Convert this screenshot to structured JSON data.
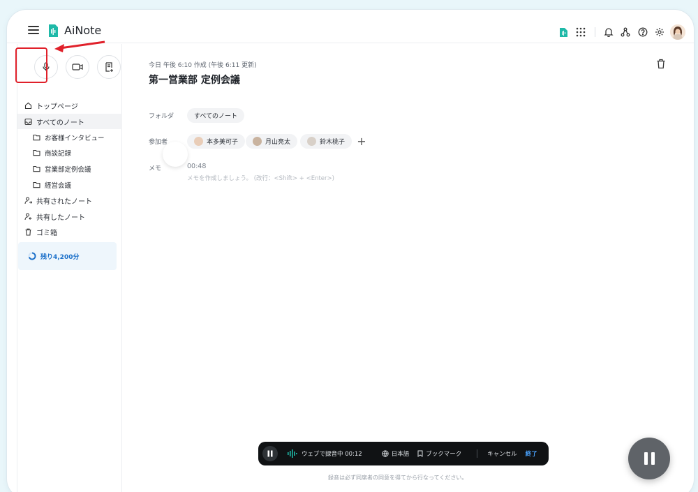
{
  "app": {
    "name": "AiNote",
    "brand_color": "#1fb9a8",
    "accent": "#1a6fc9",
    "highlight_color": "#e0202a"
  },
  "header": {
    "icons": [
      "menu-icon",
      "app-logo-icon",
      "grid-apps-icon",
      "bell-icon",
      "share-network-icon",
      "help-icon",
      "gear-icon",
      "user-avatar"
    ]
  },
  "sidebar": {
    "create_buttons": [
      "microphone-icon",
      "video-icon",
      "add-note-icon"
    ],
    "items": [
      {
        "label": "トップページ",
        "icon": "home-icon"
      },
      {
        "label": "すべてのノート",
        "icon": "inbox-icon"
      },
      {
        "label": "お客様インタビュー",
        "icon": "folder-icon"
      },
      {
        "label": "商談記録",
        "icon": "folder-icon"
      },
      {
        "label": "営業部定例会議",
        "icon": "folder-icon"
      },
      {
        "label": "経営会議",
        "icon": "folder-icon"
      },
      {
        "label": "共有されたノート",
        "icon": "shared-with-me-icon"
      },
      {
        "label": "共有したノート",
        "icon": "shared-by-me-icon"
      },
      {
        "label": "ゴミ箱",
        "icon": "trash-icon"
      }
    ],
    "quota": "残り4,200分"
  },
  "note": {
    "meta": "今日 午後 6:10 作成 (午後 6:11 更新)",
    "title": "第一営業部 定例会議",
    "folder_label": "フォルダ",
    "folder_value": "すべてのノート",
    "participants_label": "参加者",
    "participants": [
      "本多美可子",
      "月山亮太",
      "鈴木桃子"
    ],
    "memo_label": "メモ",
    "memo_time": "00:48",
    "memo_placeholder": "メモを作成しましょう。 (改行：<Shift> + <Enter>)"
  },
  "recorder": {
    "status": "ウェブで録音中 00:12",
    "language": "日本語",
    "bookmark": "ブックマーク",
    "cancel": "キャンセル",
    "finish": "終了",
    "disclaimer": "録音は必ず同席者の同意を得てから行なってください。"
  }
}
